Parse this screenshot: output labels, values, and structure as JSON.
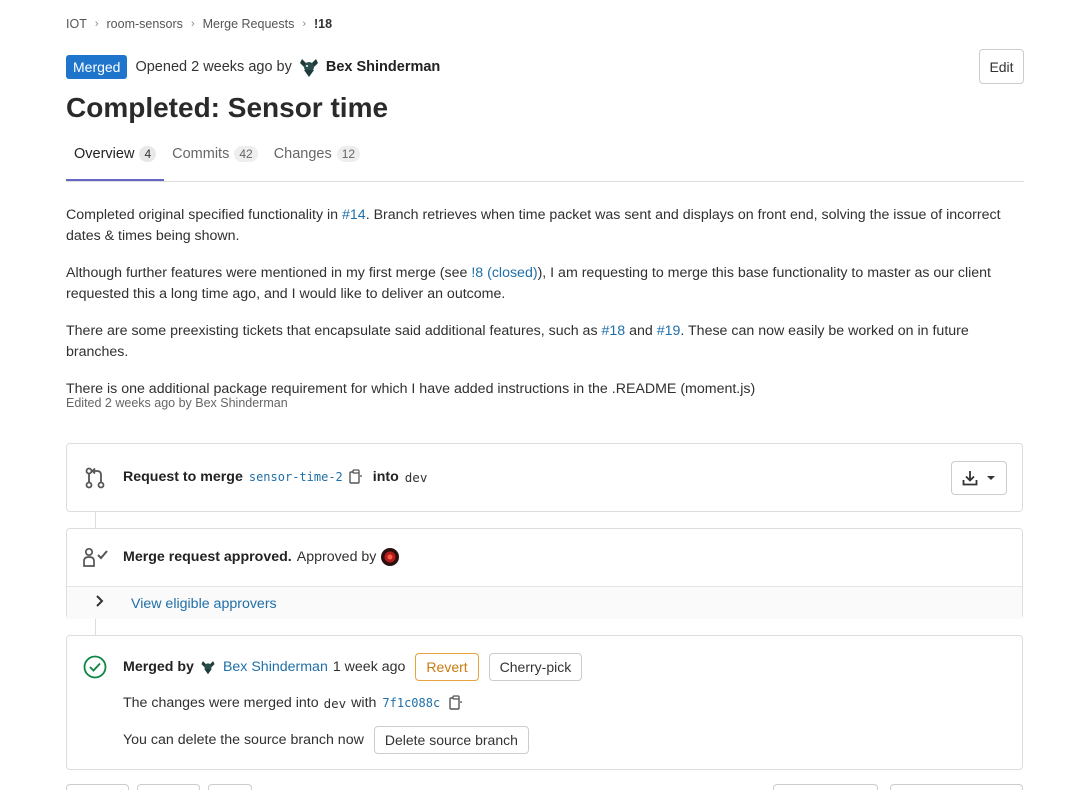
{
  "breadcrumb": [
    "IOT",
    "room-sensors",
    "Merge Requests",
    "!18"
  ],
  "header": {
    "status": "Merged",
    "opened": "Opened 2 weeks ago by",
    "author": "Bex Shinderman",
    "edit_label": "Edit"
  },
  "title": "Completed: Sensor time",
  "tabs": [
    {
      "label": "Overview",
      "count": "4"
    },
    {
      "label": "Commits",
      "count": "42"
    },
    {
      "label": "Changes",
      "count": "12"
    }
  ],
  "description": {
    "p1_a": "Completed original specified functionality in ",
    "p1_link": "#14",
    "p1_b": ". Branch retrieves when time packet was sent and displays on front end, solving the issue of incorrect dates & times being shown.",
    "p2_a": "Although further features were mentioned in my first merge (see ",
    "p2_link": "!8 (closed)",
    "p2_b": "), I am requesting to merge this base functionality to master as our client requested this a long time ago, and I would like to deliver an outcome.",
    "p3_a": "There are some preexisting tickets that encapsulate said additional features, such as ",
    "p3_link1": "#18",
    "p3_mid": " and ",
    "p3_link2": "#19",
    "p3_b": ". These can now easily be worked on in future branches.",
    "p4": "There is one additional package requirement for which I have added instructions in the .README (moment.js)"
  },
  "edited": "Edited 2 weeks ago by Bex Shinderman",
  "merge_info": {
    "request_label": "Request to merge",
    "source_branch": "sensor-time-2",
    "into_label": "into",
    "target_branch": "dev"
  },
  "approval": {
    "title": "Merge request approved.",
    "approved_by": "Approved by",
    "view_approvers": "View eligible approvers"
  },
  "merged": {
    "merged_by": "Merged by",
    "author": "Bex Shinderman",
    "time": "1 week ago",
    "revert_label": "Revert",
    "cherry_label": "Cherry-pick",
    "changes_text": "The changes were merged into",
    "target_branch": "dev",
    "with_label": "with",
    "commit": "7f1c088c",
    "delete_text": "You can delete the source branch now",
    "delete_label": "Delete source branch"
  },
  "colors": {
    "accent": "#1f75cb",
    "link": "#1f6fa8",
    "success": "#108548",
    "warning": "#e9a33c",
    "tab_active": "#6666c4"
  }
}
